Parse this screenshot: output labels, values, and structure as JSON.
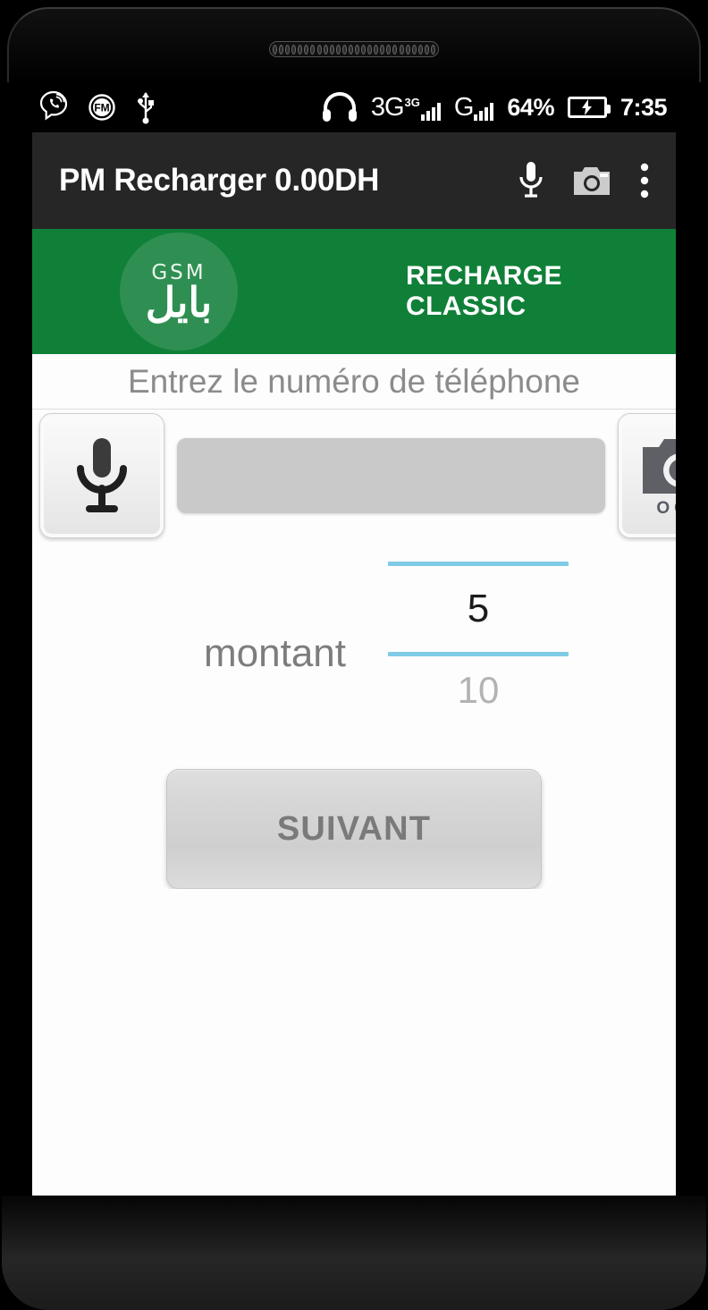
{
  "status_bar": {
    "icons_left": [
      "viber-icon",
      "fm-radio-icon",
      "usb-icon"
    ],
    "headphones_icon": "headphones-icon",
    "network_3g_label": "3G",
    "network_3g_superscript": "3G",
    "network_g_label": "G",
    "battery_percent": "64%",
    "battery_icon": "battery-charging-icon",
    "time": "7:35"
  },
  "app_bar": {
    "title": "PM Recharger 0.00DH",
    "mic_icon": "microphone-icon",
    "camera_icon": "camera-icon",
    "overflow_icon": "more-vert-icon"
  },
  "banner": {
    "logo_top_text": "GSM",
    "logo_arabic_text": "بايل",
    "title": "RECHARGE CLASSIC",
    "bg_color": "#108038",
    "logo_circle_color": "#2f8f52"
  },
  "form": {
    "phone_label": "Entrez le numéro de téléphone",
    "phone_value": "",
    "phone_placeholder": "",
    "mic_button_icon": "microphone-icon",
    "ocr_button_icon": "camera-icon",
    "ocr_button_label": "OCR"
  },
  "amount_picker": {
    "label": "montant",
    "selected_value": "5",
    "next_value": "10",
    "divider_color": "#7fcbe6"
  },
  "actions": {
    "next_button_label": "SUIVANT"
  }
}
